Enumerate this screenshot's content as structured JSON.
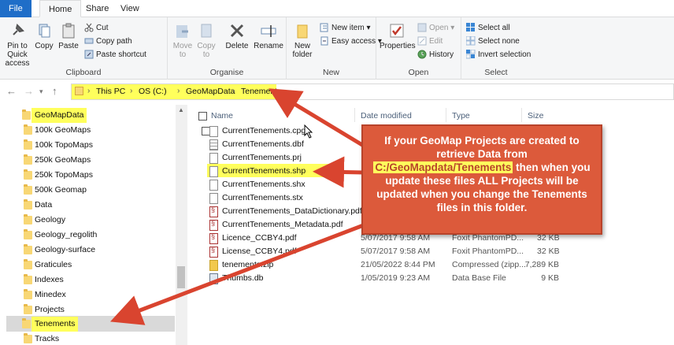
{
  "tabs": [
    "File",
    "Home",
    "Share",
    "View"
  ],
  "ribbon": {
    "clipboard": {
      "pin": "Pin to Quick access",
      "copy": "Copy",
      "paste": "Paste",
      "cut": "Cut",
      "copy_path": "Copy path",
      "paste_shortcut": "Paste shortcut",
      "label": "Clipboard"
    },
    "organise": {
      "move_to": "Move to",
      "copy_to": "Copy to",
      "delete": "Delete",
      "rename": "Rename",
      "label": "Organise"
    },
    "new": {
      "new_folder": "New folder",
      "new_item": "New item",
      "easy_access": "Easy access",
      "label": "New"
    },
    "open": {
      "properties": "Properties",
      "open": "Open",
      "edit": "Edit",
      "history": "History",
      "label": "Open"
    },
    "select": {
      "select_all": "Select all",
      "select_none": "Select none",
      "invert": "Invert selection",
      "label": "Select"
    }
  },
  "address": {
    "crumbs": [
      "This PC",
      "OS (C:)",
      "GeoMapData",
      "Tenements"
    ]
  },
  "navpane": {
    "items": [
      "GeoMapData",
      "100k GeoMaps",
      "100k TopoMaps",
      "250k GeoMaps",
      "250k TopoMaps",
      "500k Geomap",
      "Data",
      "Geology",
      "Geology_regolith",
      "Geology-surface",
      "Graticules",
      "Indexes",
      "Minedex",
      "Projects",
      "Tenements",
      "Tracks"
    ]
  },
  "filelist": {
    "columns": [
      "Name",
      "Date modified",
      "Type",
      "Size"
    ],
    "files": [
      {
        "name": "CurrentTenements.cpg",
        "date": "",
        "type": "",
        "size": ""
      },
      {
        "name": "CurrentTenements.dbf",
        "date": "",
        "type": "",
        "size": ""
      },
      {
        "name": "CurrentTenements.prj",
        "date": "",
        "type": "",
        "size": ""
      },
      {
        "name": "CurrentTenements.shp",
        "date": "",
        "type": "",
        "size": ""
      },
      {
        "name": "CurrentTenements.shx",
        "date": "",
        "type": "",
        "size": ""
      },
      {
        "name": "CurrentTenements.stx",
        "date": "",
        "type": "",
        "size": ""
      },
      {
        "name": "CurrentTenements_DataDictionary.pdf",
        "date": "",
        "type": "",
        "size": ""
      },
      {
        "name": "CurrentTenements_Metadata.pdf",
        "date": "",
        "type": "",
        "size": ""
      },
      {
        "name": "Licence_CCBY4.pdf",
        "date": "5/07/2017 9:58 AM",
        "type": "Foxit PhantomPD...",
        "size": "32 KB"
      },
      {
        "name": "License_CCBY4.pdf",
        "date": "5/07/2017 9:58 AM",
        "type": "Foxit PhantomPD...",
        "size": "32 KB"
      },
      {
        "name": "tenements.zip",
        "date": "21/05/2022 8:44 PM",
        "type": "Compressed (zipp...",
        "size": "7,289 KB"
      },
      {
        "name": "Thumbs.db",
        "date": "1/05/2019 9:23 AM",
        "type": "Data Base File",
        "size": "9 KB"
      }
    ]
  },
  "callout": {
    "line1": "If your GeoMap Projects are created to retrieve Data from",
    "path": "C:/GeoMapdata/Tenements",
    "line2": " then when you update these files ALL Projects will be updated when you change the Tenements files in this folder."
  },
  "colors": {
    "highlight": "#ffff5c",
    "callout": "#dc5a3b",
    "arrow": "#d9442f"
  }
}
